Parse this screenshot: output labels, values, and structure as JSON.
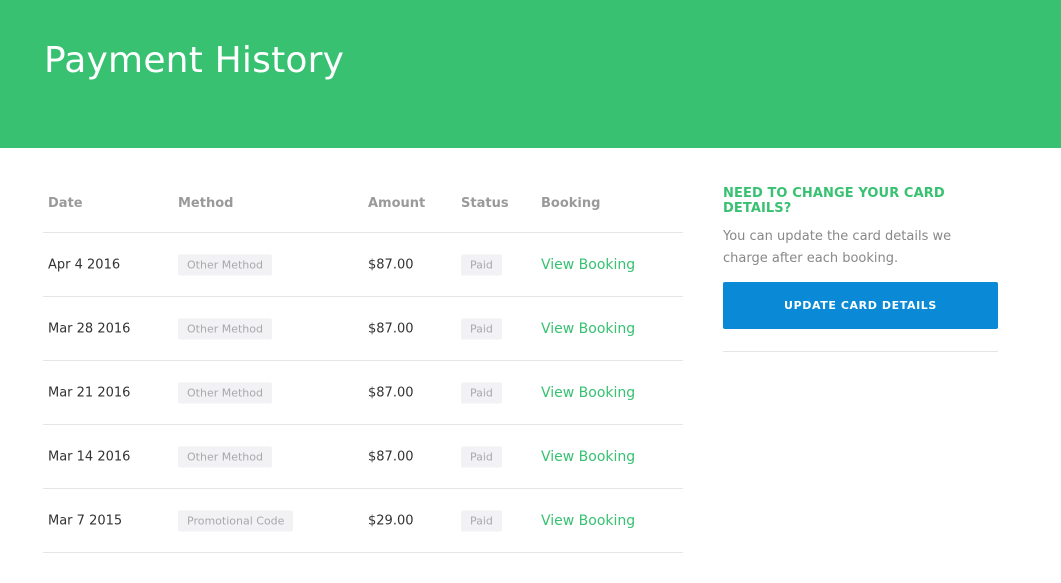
{
  "page": {
    "title": "Payment History"
  },
  "table": {
    "headers": {
      "date": "Date",
      "method": "Method",
      "amount": "Amount",
      "status": "Status",
      "booking": "Booking"
    },
    "rows": [
      {
        "date": "Apr 4 2016",
        "method": "Other Method",
        "amount": "$87.00",
        "status": "Paid",
        "booking": "View Booking"
      },
      {
        "date": "Mar 28 2016",
        "method": "Other Method",
        "amount": "$87.00",
        "status": "Paid",
        "booking": "View Booking"
      },
      {
        "date": "Mar 21 2016",
        "method": "Other Method",
        "amount": "$87.00",
        "status": "Paid",
        "booking": "View Booking"
      },
      {
        "date": "Mar 14 2016",
        "method": "Other Method",
        "amount": "$87.00",
        "status": "Paid",
        "booking": "View Booking"
      },
      {
        "date": "Mar 7 2015",
        "method": "Promotional Code",
        "amount": "$29.00",
        "status": "Paid",
        "booking": "View Booking"
      }
    ]
  },
  "side": {
    "title": "NEED TO CHANGE YOUR CARD DETAILS?",
    "text": "You can update the card details we charge after each booking.",
    "button_label": "UPDATE CARD DETAILS"
  },
  "colors": {
    "brand_green": "#37c171",
    "button_blue": "#0a8ad6",
    "pill_bg": "#f2f2f5"
  }
}
